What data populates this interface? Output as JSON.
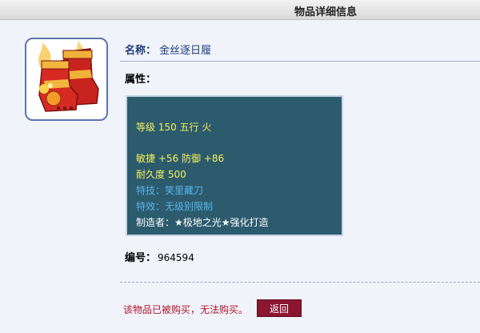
{
  "header": {
    "title": "物品详细信息"
  },
  "item": {
    "name_label": "名称：",
    "name": "金丝逐日履",
    "icon": "boots-item-icon",
    "attr_label": "属性：",
    "attributes": {
      "level_line": "等级 150 五行 火",
      "stats_line": "敏捷 +56 防御 +86",
      "durability_line": "耐久度 500",
      "skill_line": "特技：笑里藏刀",
      "effect_line": "特效：无级别限制",
      "maker_line": "制造者：★极地之光★强化打造"
    },
    "id_label": "编号：",
    "id": "964594"
  },
  "footer": {
    "message": "该物品已被购买，无法购买。",
    "back_label": "返回"
  },
  "colors": {
    "attr_bg": "#2c5b6e",
    "yellow_text": "#f4f05a",
    "blue_text": "#58b6ea",
    "button_bg": "#8c1630",
    "message_color": "#b3152c"
  }
}
